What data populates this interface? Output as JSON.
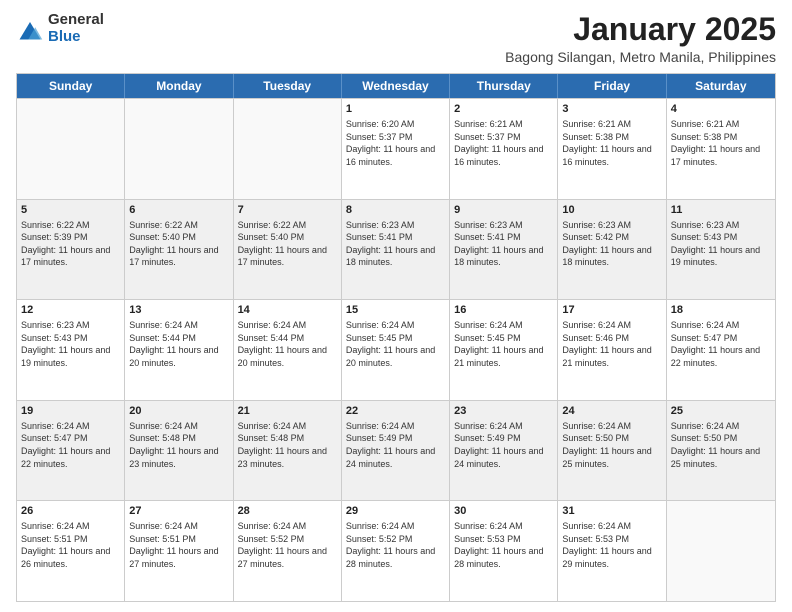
{
  "logo": {
    "general": "General",
    "blue": "Blue"
  },
  "header": {
    "title": "January 2025",
    "subtitle": "Bagong Silangan, Metro Manila, Philippines"
  },
  "days": [
    "Sunday",
    "Monday",
    "Tuesday",
    "Wednesday",
    "Thursday",
    "Friday",
    "Saturday"
  ],
  "weeks": [
    [
      {
        "day": "",
        "sunrise": "",
        "sunset": "",
        "daylight": "",
        "empty": true
      },
      {
        "day": "",
        "sunrise": "",
        "sunset": "",
        "daylight": "",
        "empty": true
      },
      {
        "day": "",
        "sunrise": "",
        "sunset": "",
        "daylight": "",
        "empty": true
      },
      {
        "day": "1",
        "sunrise": "Sunrise: 6:20 AM",
        "sunset": "Sunset: 5:37 PM",
        "daylight": "Daylight: 11 hours and 16 minutes.",
        "empty": false
      },
      {
        "day": "2",
        "sunrise": "Sunrise: 6:21 AM",
        "sunset": "Sunset: 5:37 PM",
        "daylight": "Daylight: 11 hours and 16 minutes.",
        "empty": false
      },
      {
        "day": "3",
        "sunrise": "Sunrise: 6:21 AM",
        "sunset": "Sunset: 5:38 PM",
        "daylight": "Daylight: 11 hours and 16 minutes.",
        "empty": false
      },
      {
        "day": "4",
        "sunrise": "Sunrise: 6:21 AM",
        "sunset": "Sunset: 5:38 PM",
        "daylight": "Daylight: 11 hours and 17 minutes.",
        "empty": false
      }
    ],
    [
      {
        "day": "5",
        "sunrise": "Sunrise: 6:22 AM",
        "sunset": "Sunset: 5:39 PM",
        "daylight": "Daylight: 11 hours and 17 minutes.",
        "empty": false
      },
      {
        "day": "6",
        "sunrise": "Sunrise: 6:22 AM",
        "sunset": "Sunset: 5:40 PM",
        "daylight": "Daylight: 11 hours and 17 minutes.",
        "empty": false
      },
      {
        "day": "7",
        "sunrise": "Sunrise: 6:22 AM",
        "sunset": "Sunset: 5:40 PM",
        "daylight": "Daylight: 11 hours and 17 minutes.",
        "empty": false
      },
      {
        "day": "8",
        "sunrise": "Sunrise: 6:23 AM",
        "sunset": "Sunset: 5:41 PM",
        "daylight": "Daylight: 11 hours and 18 minutes.",
        "empty": false
      },
      {
        "day": "9",
        "sunrise": "Sunrise: 6:23 AM",
        "sunset": "Sunset: 5:41 PM",
        "daylight": "Daylight: 11 hours and 18 minutes.",
        "empty": false
      },
      {
        "day": "10",
        "sunrise": "Sunrise: 6:23 AM",
        "sunset": "Sunset: 5:42 PM",
        "daylight": "Daylight: 11 hours and 18 minutes.",
        "empty": false
      },
      {
        "day": "11",
        "sunrise": "Sunrise: 6:23 AM",
        "sunset": "Sunset: 5:43 PM",
        "daylight": "Daylight: 11 hours and 19 minutes.",
        "empty": false
      }
    ],
    [
      {
        "day": "12",
        "sunrise": "Sunrise: 6:23 AM",
        "sunset": "Sunset: 5:43 PM",
        "daylight": "Daylight: 11 hours and 19 minutes.",
        "empty": false
      },
      {
        "day": "13",
        "sunrise": "Sunrise: 6:24 AM",
        "sunset": "Sunset: 5:44 PM",
        "daylight": "Daylight: 11 hours and 20 minutes.",
        "empty": false
      },
      {
        "day": "14",
        "sunrise": "Sunrise: 6:24 AM",
        "sunset": "Sunset: 5:44 PM",
        "daylight": "Daylight: 11 hours and 20 minutes.",
        "empty": false
      },
      {
        "day": "15",
        "sunrise": "Sunrise: 6:24 AM",
        "sunset": "Sunset: 5:45 PM",
        "daylight": "Daylight: 11 hours and 20 minutes.",
        "empty": false
      },
      {
        "day": "16",
        "sunrise": "Sunrise: 6:24 AM",
        "sunset": "Sunset: 5:45 PM",
        "daylight": "Daylight: 11 hours and 21 minutes.",
        "empty": false
      },
      {
        "day": "17",
        "sunrise": "Sunrise: 6:24 AM",
        "sunset": "Sunset: 5:46 PM",
        "daylight": "Daylight: 11 hours and 21 minutes.",
        "empty": false
      },
      {
        "day": "18",
        "sunrise": "Sunrise: 6:24 AM",
        "sunset": "Sunset: 5:47 PM",
        "daylight": "Daylight: 11 hours and 22 minutes.",
        "empty": false
      }
    ],
    [
      {
        "day": "19",
        "sunrise": "Sunrise: 6:24 AM",
        "sunset": "Sunset: 5:47 PM",
        "daylight": "Daylight: 11 hours and 22 minutes.",
        "empty": false
      },
      {
        "day": "20",
        "sunrise": "Sunrise: 6:24 AM",
        "sunset": "Sunset: 5:48 PM",
        "daylight": "Daylight: 11 hours and 23 minutes.",
        "empty": false
      },
      {
        "day": "21",
        "sunrise": "Sunrise: 6:24 AM",
        "sunset": "Sunset: 5:48 PM",
        "daylight": "Daylight: 11 hours and 23 minutes.",
        "empty": false
      },
      {
        "day": "22",
        "sunrise": "Sunrise: 6:24 AM",
        "sunset": "Sunset: 5:49 PM",
        "daylight": "Daylight: 11 hours and 24 minutes.",
        "empty": false
      },
      {
        "day": "23",
        "sunrise": "Sunrise: 6:24 AM",
        "sunset": "Sunset: 5:49 PM",
        "daylight": "Daylight: 11 hours and 24 minutes.",
        "empty": false
      },
      {
        "day": "24",
        "sunrise": "Sunrise: 6:24 AM",
        "sunset": "Sunset: 5:50 PM",
        "daylight": "Daylight: 11 hours and 25 minutes.",
        "empty": false
      },
      {
        "day": "25",
        "sunrise": "Sunrise: 6:24 AM",
        "sunset": "Sunset: 5:50 PM",
        "daylight": "Daylight: 11 hours and 25 minutes.",
        "empty": false
      }
    ],
    [
      {
        "day": "26",
        "sunrise": "Sunrise: 6:24 AM",
        "sunset": "Sunset: 5:51 PM",
        "daylight": "Daylight: 11 hours and 26 minutes.",
        "empty": false
      },
      {
        "day": "27",
        "sunrise": "Sunrise: 6:24 AM",
        "sunset": "Sunset: 5:51 PM",
        "daylight": "Daylight: 11 hours and 27 minutes.",
        "empty": false
      },
      {
        "day": "28",
        "sunrise": "Sunrise: 6:24 AM",
        "sunset": "Sunset: 5:52 PM",
        "daylight": "Daylight: 11 hours and 27 minutes.",
        "empty": false
      },
      {
        "day": "29",
        "sunrise": "Sunrise: 6:24 AM",
        "sunset": "Sunset: 5:52 PM",
        "daylight": "Daylight: 11 hours and 28 minutes.",
        "empty": false
      },
      {
        "day": "30",
        "sunrise": "Sunrise: 6:24 AM",
        "sunset": "Sunset: 5:53 PM",
        "daylight": "Daylight: 11 hours and 28 minutes.",
        "empty": false
      },
      {
        "day": "31",
        "sunrise": "Sunrise: 6:24 AM",
        "sunset": "Sunset: 5:53 PM",
        "daylight": "Daylight: 11 hours and 29 minutes.",
        "empty": false
      },
      {
        "day": "",
        "sunrise": "",
        "sunset": "",
        "daylight": "",
        "empty": true
      }
    ]
  ]
}
